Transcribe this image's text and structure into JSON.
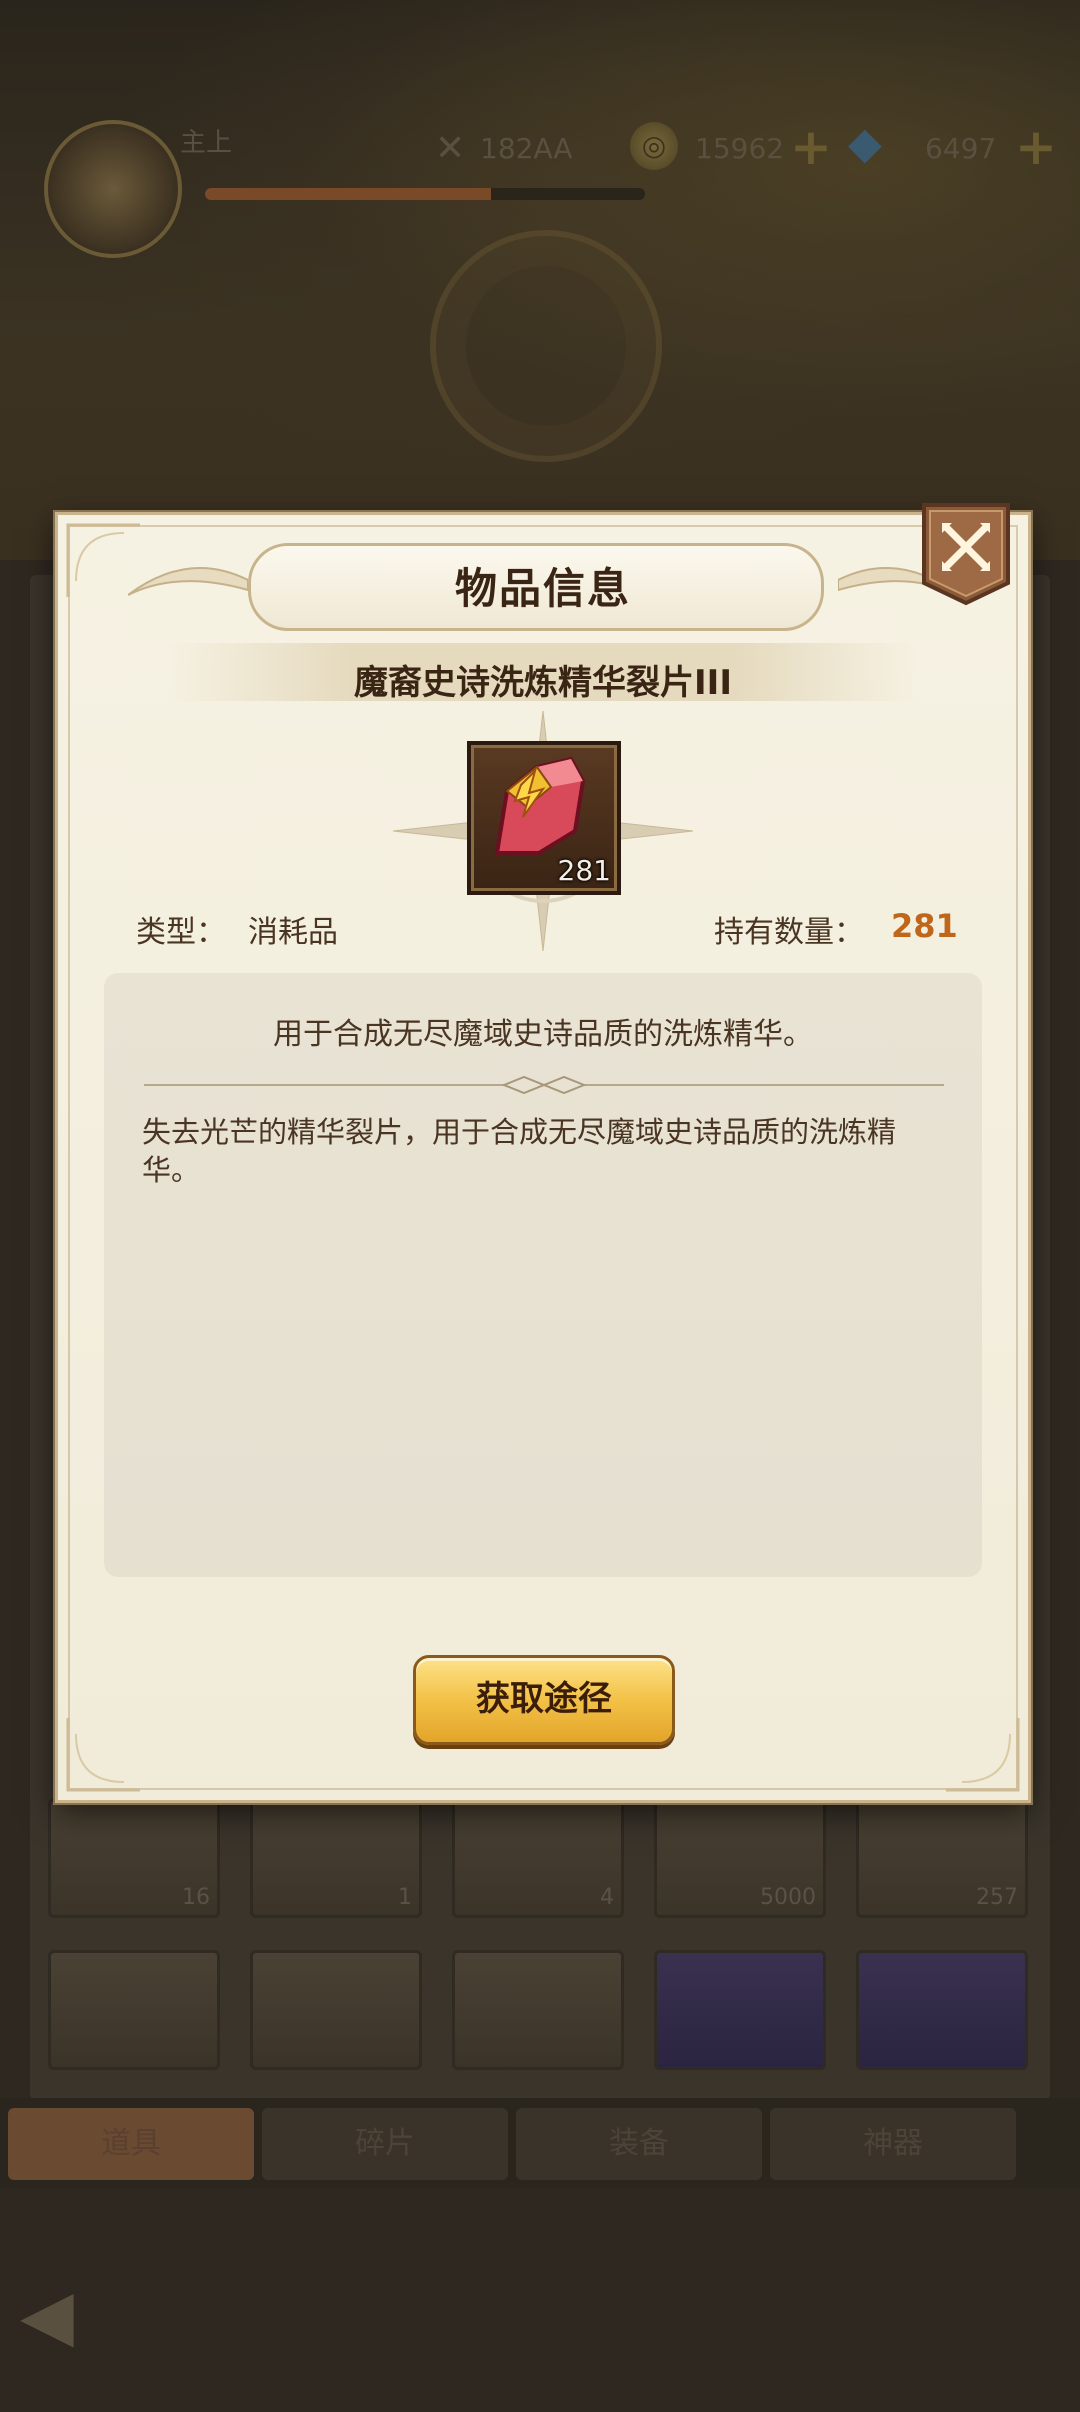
{
  "background": {
    "player_name": "主上",
    "exp_progress_percent": 65,
    "power": "182AA",
    "gold": "15962",
    "gems": "6497",
    "slots_row1": [
      {
        "count": "16",
        "style": "normal"
      },
      {
        "count": "1",
        "style": "normal"
      },
      {
        "count": "4",
        "style": "normal"
      },
      {
        "count": "5000",
        "style": "normal"
      },
      {
        "count": "257",
        "style": "normal"
      }
    ],
    "slots_row2": [
      {
        "count": "",
        "style": "normal"
      },
      {
        "count": "",
        "style": "normal"
      },
      {
        "count": "",
        "style": "normal"
      },
      {
        "count": "",
        "style": "purple"
      },
      {
        "count": "",
        "style": "purple"
      }
    ],
    "tabs": [
      "道具",
      "碎片",
      "装备",
      "神器"
    ]
  },
  "modal": {
    "title": "物品信息",
    "item_name": "魔裔史诗洗炼精华裂片III",
    "item_count_badge": "281",
    "type_label": "类型：",
    "type_value": "消耗品",
    "count_label": "持有数量：",
    "count_value": "281",
    "summary": "用于合成无尽魔域史诗品质的洗炼精华。",
    "description": "失去光芒的精华裂片，用于合成无尽魔域史诗品质的洗炼精华。",
    "acquire_button": "获取途径"
  },
  "colors": {
    "accent_orange": "#c0661a",
    "button_gold": "#f3c147",
    "text_brown": "#4a3422"
  }
}
